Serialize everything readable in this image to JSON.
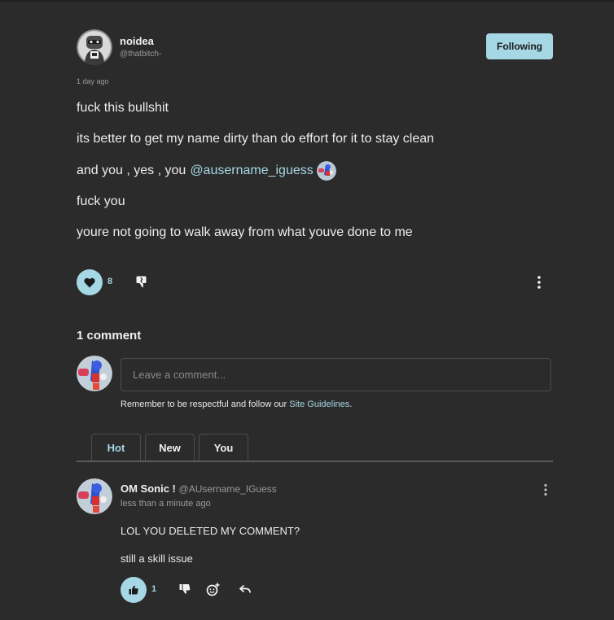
{
  "post": {
    "author_name": "noidea",
    "author_handle": "@thatbitch-",
    "follow_label": "Following",
    "timestamp": "1 day ago",
    "lines": [
      "fuck this bullshit",
      "its better to get my name dirty than do effort for it to stay clean",
      "and you , yes , you",
      "fuck you",
      "youre not going to walk away from what youve done to me"
    ],
    "mention": "@ausername_iguess",
    "like_count": "8"
  },
  "comments_section": {
    "count_label": "1 comment",
    "input_placeholder": "Leave a comment...",
    "guidelines_text": "Remember to be respectful and follow our ",
    "guidelines_link": "Site Guidelines",
    "guidelines_end": ".",
    "tabs": [
      "Hot",
      "New",
      "You"
    ],
    "active_tab": "Hot"
  },
  "comment": {
    "author_name": "OM Sonic !",
    "author_handle": "@AUsername_IGuess",
    "time": "less than a minute ago",
    "lines": [
      "LOL YOU DELETED MY COMMENT?",
      "still a skill issue"
    ],
    "like_count": "1"
  },
  "colors": {
    "background": "#2b2b2b",
    "accent": "#a6d7e4",
    "text": "#ececec",
    "muted": "#9a9a9a"
  },
  "icons": {
    "like": "heart-icon",
    "dislike": "broken-heart-icon",
    "more": "vertical-dots-icon",
    "comment_like": "thumbs-up-icon",
    "comment_dislike": "thumbs-down-icon",
    "react": "add-reaction-icon",
    "reply": "reply-arrow-icon"
  }
}
